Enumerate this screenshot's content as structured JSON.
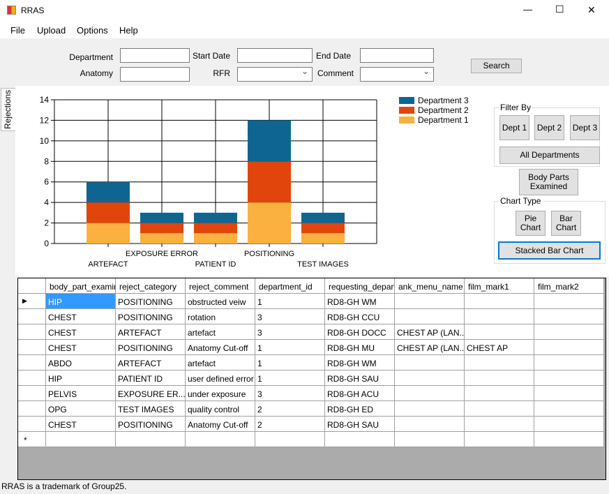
{
  "window": {
    "title": "RRAS",
    "minimize": "—",
    "maximize": "☐",
    "close": "✕"
  },
  "menu": [
    "File",
    "Upload",
    "Options",
    "Help"
  ],
  "filters": {
    "department_label": "Department",
    "department_value": "",
    "anatomy_label": "Anatomy",
    "anatomy_value": "",
    "start_date_label": "Start Date",
    "start_date_value": "",
    "end_date_label": "End Date",
    "end_date_value": "",
    "rfr_label": "RFR",
    "rfr_value": "",
    "comment_label": "Comment",
    "comment_value": "",
    "search": "Search"
  },
  "side_tab": "Rejections",
  "chart_data": {
    "type": "bar",
    "stacked": true,
    "categories": [
      "ARTEFACT",
      "EXPOSURE ERROR",
      "PATIENT ID",
      "POSITIONING",
      "TEST IMAGES"
    ],
    "series": [
      {
        "name": "Department 1",
        "values": [
          2,
          1,
          1,
          4,
          1
        ],
        "color": "#fbb040"
      },
      {
        "name": "Department 2",
        "values": [
          2,
          1,
          1,
          4,
          1
        ],
        "color": "#e2450c"
      },
      {
        "name": "Department 3",
        "values": [
          2,
          1,
          1,
          4,
          1
        ],
        "color": "#0f6591"
      }
    ],
    "ylim": [
      0,
      14
    ],
    "yticks": [
      0,
      2,
      4,
      6,
      8,
      10,
      12,
      14
    ],
    "grid": true,
    "legend": "top-right"
  },
  "panel": {
    "filter_by": "Filter By",
    "dept1": "Dept 1",
    "dept2": "Dept 2",
    "dept3": "Dept 3",
    "all": "All Departments",
    "body_parts": "Body Parts Examined",
    "chart_type": "Chart Type",
    "pie": "Pie Chart",
    "bar": "Bar Chart",
    "stacked": "Stacked Bar Chart"
  },
  "table": {
    "columns": [
      "body_part_examine",
      "reject_category",
      "reject_comment",
      "department_id",
      "requesting_departm",
      "ank_menu_name",
      "film_mark1",
      "film_mark2"
    ],
    "rows": [
      [
        "HIP",
        "POSITIONING",
        "obstructed veiw",
        "1",
        "RD8-GH WM",
        "",
        "",
        ""
      ],
      [
        "CHEST",
        "POSITIONING",
        "rotation",
        "3",
        "RD8-GH CCU",
        "",
        "",
        ""
      ],
      [
        "CHEST",
        "ARTEFACT",
        "artefact",
        "3",
        "RD8-GH DOCC",
        "CHEST AP (LAN...",
        "",
        ""
      ],
      [
        "CHEST",
        "POSITIONING",
        "Anatomy Cut-off",
        "1",
        "RD8-GH MU",
        "CHEST AP (LAN...",
        "CHEST AP",
        ""
      ],
      [
        "ABDO",
        "ARTEFACT",
        "artefact",
        "1",
        "RD8-GH WM",
        "",
        "",
        ""
      ],
      [
        "HIP",
        "PATIENT ID",
        "user defined error",
        "1",
        "RD8-GH SAU",
        "",
        "",
        ""
      ],
      [
        "PELVIS",
        "EXPOSURE ER...",
        "under exposure",
        "3",
        "RD8-GH ACU",
        "",
        "",
        ""
      ],
      [
        "OPG",
        "TEST IMAGES",
        "quality control",
        "2",
        "RD8-GH ED",
        "",
        "",
        ""
      ],
      [
        "CHEST",
        "POSITIONING",
        "Anatomy Cut-off",
        "2",
        "RD8-GH SAU",
        "",
        "",
        ""
      ]
    ],
    "current_row_marker": "▶",
    "new_row_marker": "*"
  },
  "status": "RRAS is a trademark of Group25."
}
